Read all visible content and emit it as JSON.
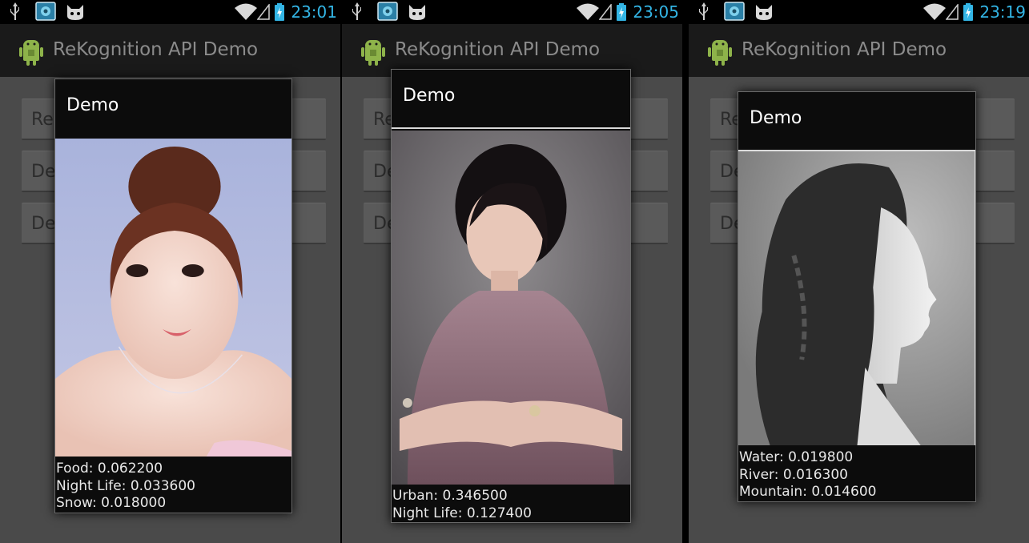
{
  "app": {
    "title": "ReKognition API Demo"
  },
  "background_buttons": {
    "repick_label": "Repick an image",
    "demo_label_a": "De",
    "demo_label_b": "De"
  },
  "screens": [
    {
      "clock": "23:01",
      "dialog_title": "Demo",
      "results": [
        {
          "label": "Food",
          "score": "0.062200",
          "text": "Food: 0.062200"
        },
        {
          "label": "Night Life",
          "score": "0.033600",
          "text": "Night Life: 0.033600"
        },
        {
          "label": "Snow",
          "score": "0.018000",
          "text": "Snow: 0.018000"
        }
      ]
    },
    {
      "clock": "23:05",
      "dialog_title": "Demo",
      "results": [
        {
          "label": "Urban",
          "score": "0.346500",
          "text": "Urban: 0.346500"
        },
        {
          "label": "Night Life",
          "score": "0.127400",
          "text": "Night Life: 0.127400"
        }
      ]
    },
    {
      "clock": "23:19",
      "dialog_title": "Demo",
      "results": [
        {
          "label": "Water",
          "score": "0.019800",
          "text": "Water: 0.019800"
        },
        {
          "label": "River",
          "score": "0.016300",
          "text": "River: 0.016300"
        },
        {
          "label": "Mountain",
          "score": "0.014600",
          "text": "Mountain: 0.014600"
        }
      ]
    }
  ],
  "colors": {
    "clock": "#33b5e5",
    "android_green": "#8eb34a",
    "statusbar": "#000000",
    "actionbar": "#1a1a1a",
    "dialog_bg": "#0c0c0c",
    "dim_background": "#4a4a4a"
  },
  "icons": [
    "usb-icon",
    "gallery-icon",
    "cat-icon",
    "wifi-icon",
    "signal-icon",
    "battery-icon",
    "android-logo-icon"
  ]
}
